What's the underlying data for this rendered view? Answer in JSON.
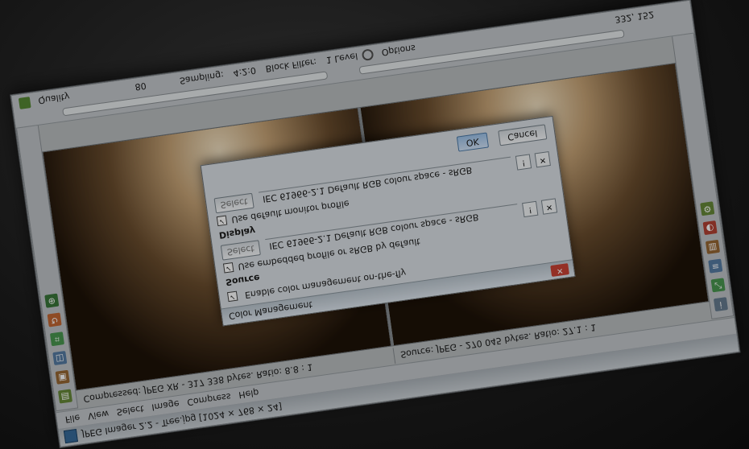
{
  "window": {
    "title": "JPEG Imager 2.2 - Tree.jpg [1024 × 768 × 24]",
    "menu": [
      "File",
      "View",
      "Select",
      "Image",
      "Compress",
      "Help"
    ]
  },
  "status": {
    "compressed": "Compressed: JPEG XR - 317 338 bytes. Ratio: 8.8 : 1",
    "source": "Source: JPEG - 270 045 bytes. Ratio: 27.1 : 1"
  },
  "settings": {
    "quality_label": "Quality",
    "quality_value": "80",
    "sampling_label": "Sampling:",
    "sampling_value": "4:2:0",
    "block_filter_label": "Block Filter:",
    "block_filter_value": "1 Level",
    "options_label": "Options",
    "coords": "332, 152"
  },
  "dialog": {
    "title": "Color Management",
    "close_label": "✕",
    "enable_label": "Enable color management on-the-fly",
    "source_group": "Source",
    "source_check": "Use embedded profile or sRGB by default",
    "source_button": "Select",
    "source_profile": "IEC 61966-2.1 Default RGB colour space - sRGB",
    "display_group": "Display",
    "display_check": "Use default monitor profile",
    "display_button": "Select",
    "display_profile": "IEC 61966-2.1 Default RGB colour space - sRGB",
    "ok_label": "OK",
    "cancel_label": "Cancel"
  },
  "colors": {
    "accent": "#3d6f9e",
    "photo_sky": "#f2e2c4",
    "photo_shadow": "#24190f"
  }
}
